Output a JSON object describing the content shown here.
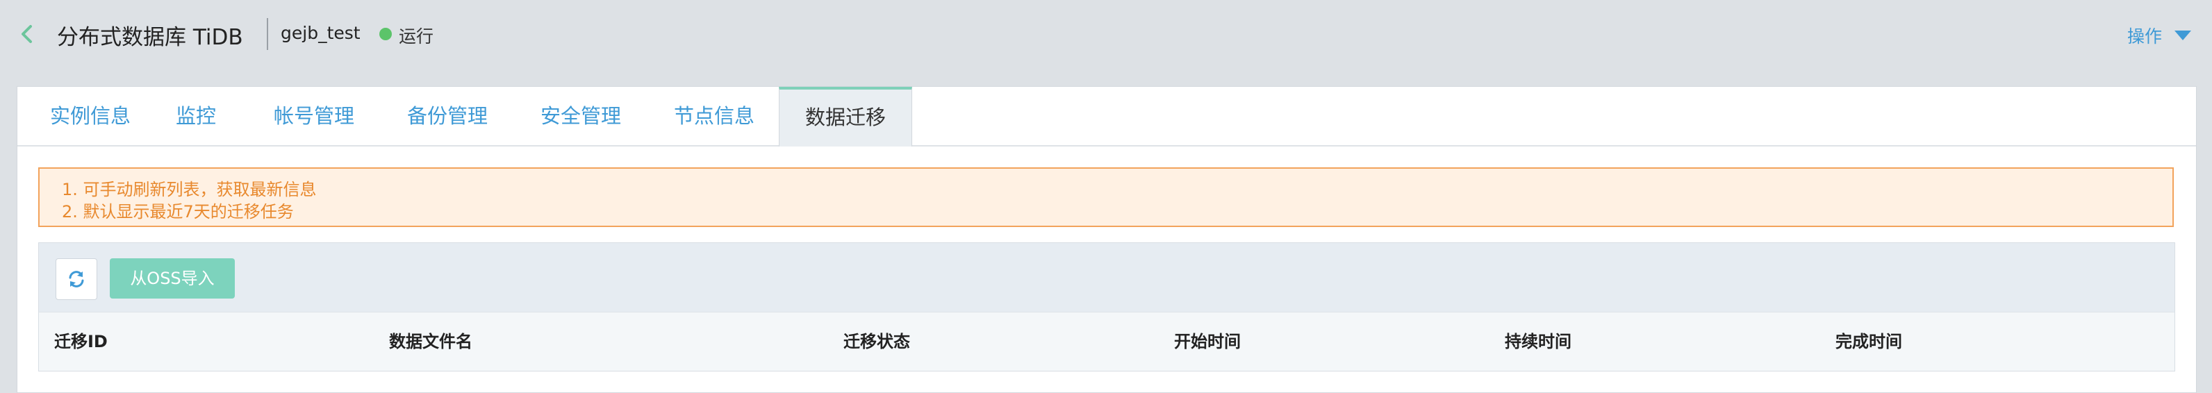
{
  "header": {
    "title": "分布式数据库 TiDB",
    "instance_name": "gejb_test",
    "status": "运行",
    "status_color": "#5cc46a",
    "ops_label": "操作"
  },
  "tabs": [
    {
      "label": "实例信息"
    },
    {
      "label": "监控"
    },
    {
      "label": "帐号管理"
    },
    {
      "label": "备份管理"
    },
    {
      "label": "安全管理"
    },
    {
      "label": "节点信息"
    },
    {
      "label": "数据迁移",
      "active": true
    }
  ],
  "notice": {
    "lines": [
      "1. 可手动刷新列表，获取最新信息",
      "2. 默认显示最近7天的迁移任务"
    ]
  },
  "toolbar": {
    "refresh_icon": "refresh-icon",
    "import_label": "从OSS导入"
  },
  "table": {
    "columns": [
      "迁移ID",
      "数据文件名",
      "迁移状态",
      "开始时间",
      "持续时间",
      "完成时间"
    ]
  },
  "colors": {
    "accent": "#3f9ad6",
    "primary_button": "#7dd3bd",
    "notice_border": "#f2a35c",
    "notice_text": "#e8892e"
  }
}
